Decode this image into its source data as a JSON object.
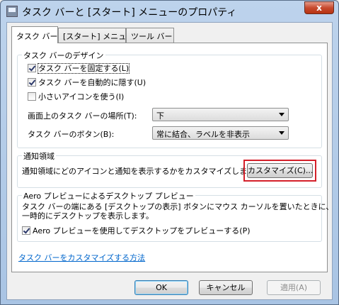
{
  "window": {
    "title": "タスク バーと [スタート] メニューのプロパティ",
    "close_glyph": "x"
  },
  "tabs": [
    {
      "label": "タスク バー",
      "active": true
    },
    {
      "label": "[スタート] メニュー",
      "active": false
    },
    {
      "label": "ツール バー",
      "active": false
    }
  ],
  "taskbar_design": {
    "title": "タスク バーのデザイン",
    "checkboxes": [
      {
        "label": "タスク バーを固定する(L)",
        "checked": true
      },
      {
        "label": "タスク バーを自動的に隠す(U)",
        "checked": true
      },
      {
        "label": "小さいアイコンを使う(I)",
        "checked": false
      }
    ],
    "location_label": "画面上のタスク バーの場所(T):",
    "location_value": "下",
    "buttons_label": "タスク バーのボタン(B):",
    "buttons_value": "常に結合、ラベルを非表示"
  },
  "notification_area": {
    "title": "通知領域",
    "description": "通知領域にどのアイコンと通知を表示するかをカスタマイズしま す。",
    "customize_button": "カスタマイズ(C)..."
  },
  "aero_peek": {
    "title": "Aero プレビューによるデスクトップ プレビュー",
    "line1": "タスク バーの端にある [デスクトップの表示] ボタンにマウス カーソルを置いたときに、",
    "line2": "一時的にデスクトップを表示します。",
    "checkbox_label": "Aero プレビューを使用してデスクトップをプレビューする(P)",
    "checked": true
  },
  "help_link": "タスク バーをカスタマイズする方法",
  "footer": {
    "ok": "OK",
    "cancel": "キャンセル",
    "apply": "適用(A)"
  },
  "colors": {
    "highlight": "#d4202a",
    "link": "#0066cc"
  }
}
